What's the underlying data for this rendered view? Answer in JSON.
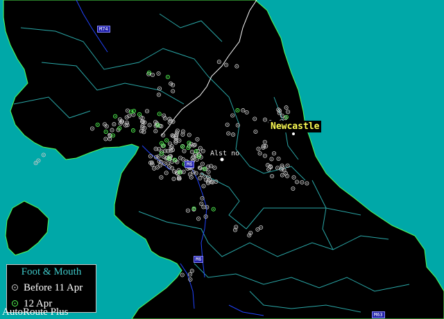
{
  "map": {
    "colors": {
      "sea": "#00a8a8",
      "land": "#000000",
      "coast": "#55ff55",
      "border": "#ffffff",
      "boundary": "#2aa8a8",
      "river": "#2244ff",
      "before_dot": "#c8c8c8",
      "recent_dot": "#55ff55"
    }
  },
  "places": {
    "newcastle": "Newcastle",
    "alston": "Alst no"
  },
  "roads": {
    "m74": "M74",
    "m6_north": "M6",
    "m6_south": "M6",
    "m63": "M63"
  },
  "legend": {
    "title": "Foot & Mouth",
    "before_label": "Before 11 Apr",
    "recent_label": "12 Apr"
  },
  "app": {
    "name": "AutoRoute Plus"
  }
}
